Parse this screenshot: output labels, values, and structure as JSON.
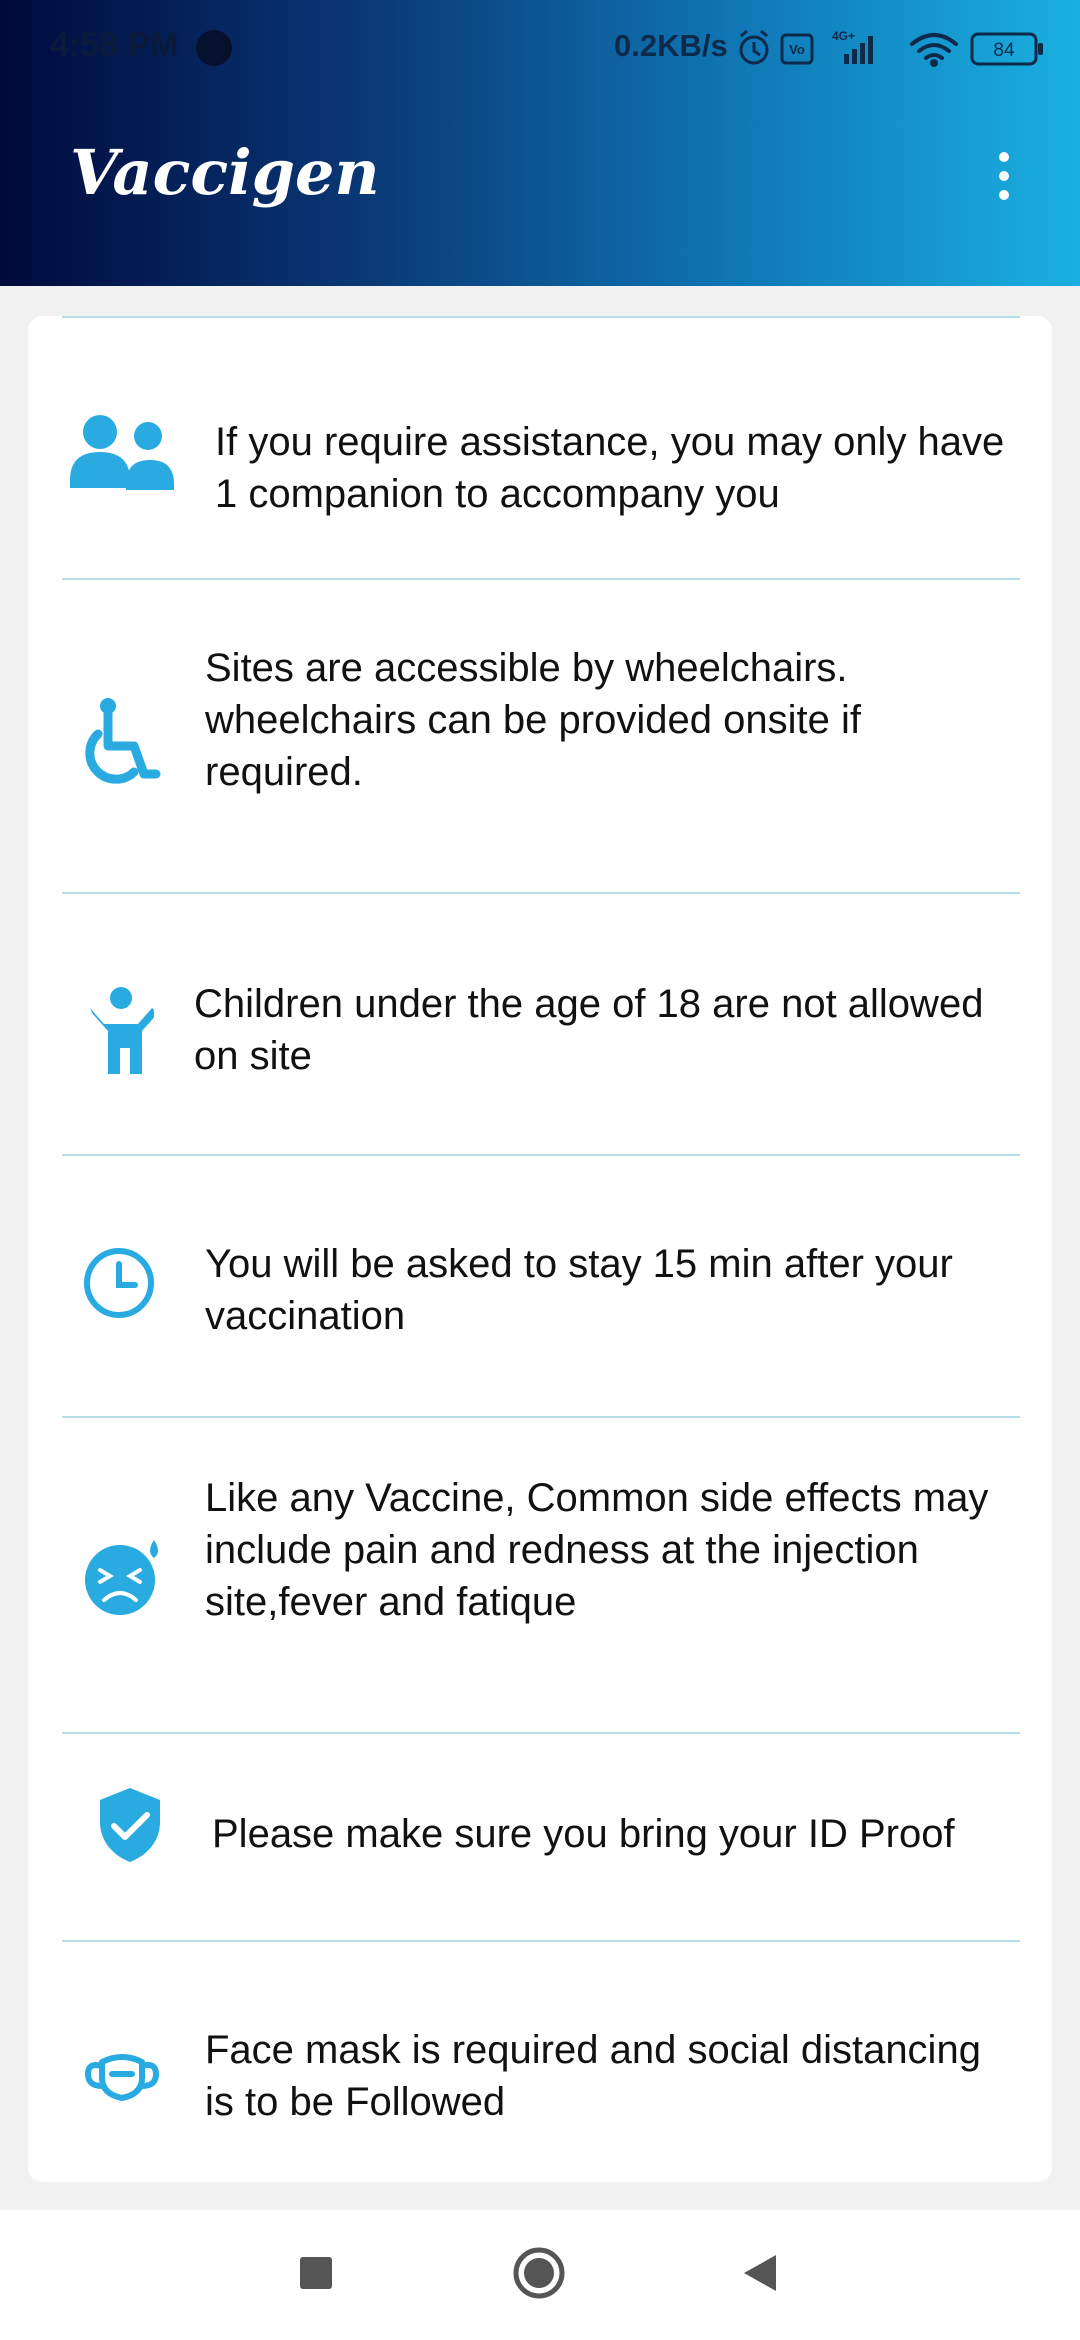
{
  "status_bar": {
    "time": "4:58 PM",
    "net_speed": "0.2KB/s",
    "battery": "84",
    "network": "4G+",
    "icons": [
      "alarm-icon",
      "volte-icon",
      "signal-icon",
      "wifi-icon",
      "battery-icon"
    ]
  },
  "app_bar": {
    "title": "Vaccigen",
    "menu_icon": "more-vert-icon"
  },
  "colors": {
    "accent": "#29ABE2",
    "divider": "#b6dfe9",
    "appbar_start": "#000a3c",
    "appbar_end": "#1ab0e0"
  },
  "guidelines": [
    {
      "icon": "people-icon",
      "text": "If you require assistance, you may only have 1 companion to accompany you"
    },
    {
      "icon": "wheelchair-icon",
      "text": "Sites are accessible by wheelchairs. wheelchairs can be provided onsite if required."
    },
    {
      "icon": "child-icon",
      "text": "Children under the age of 18 are not allowed on site"
    },
    {
      "icon": "clock-icon",
      "text": "You will be asked to stay 15 min after your vaccination"
    },
    {
      "icon": "sick-face-icon",
      "text": "Like any Vaccine, Common side effects may include pain and redness at the injection site,fever and fatique"
    },
    {
      "icon": "verified-shield-icon",
      "text": "Please make sure you bring your ID Proof"
    },
    {
      "icon": "face-mask-icon",
      "text": "Face mask is required and social distancing is to be Followed"
    }
  ],
  "nav_bar": {
    "buttons": [
      "recents-button",
      "home-button",
      "back-button"
    ]
  }
}
